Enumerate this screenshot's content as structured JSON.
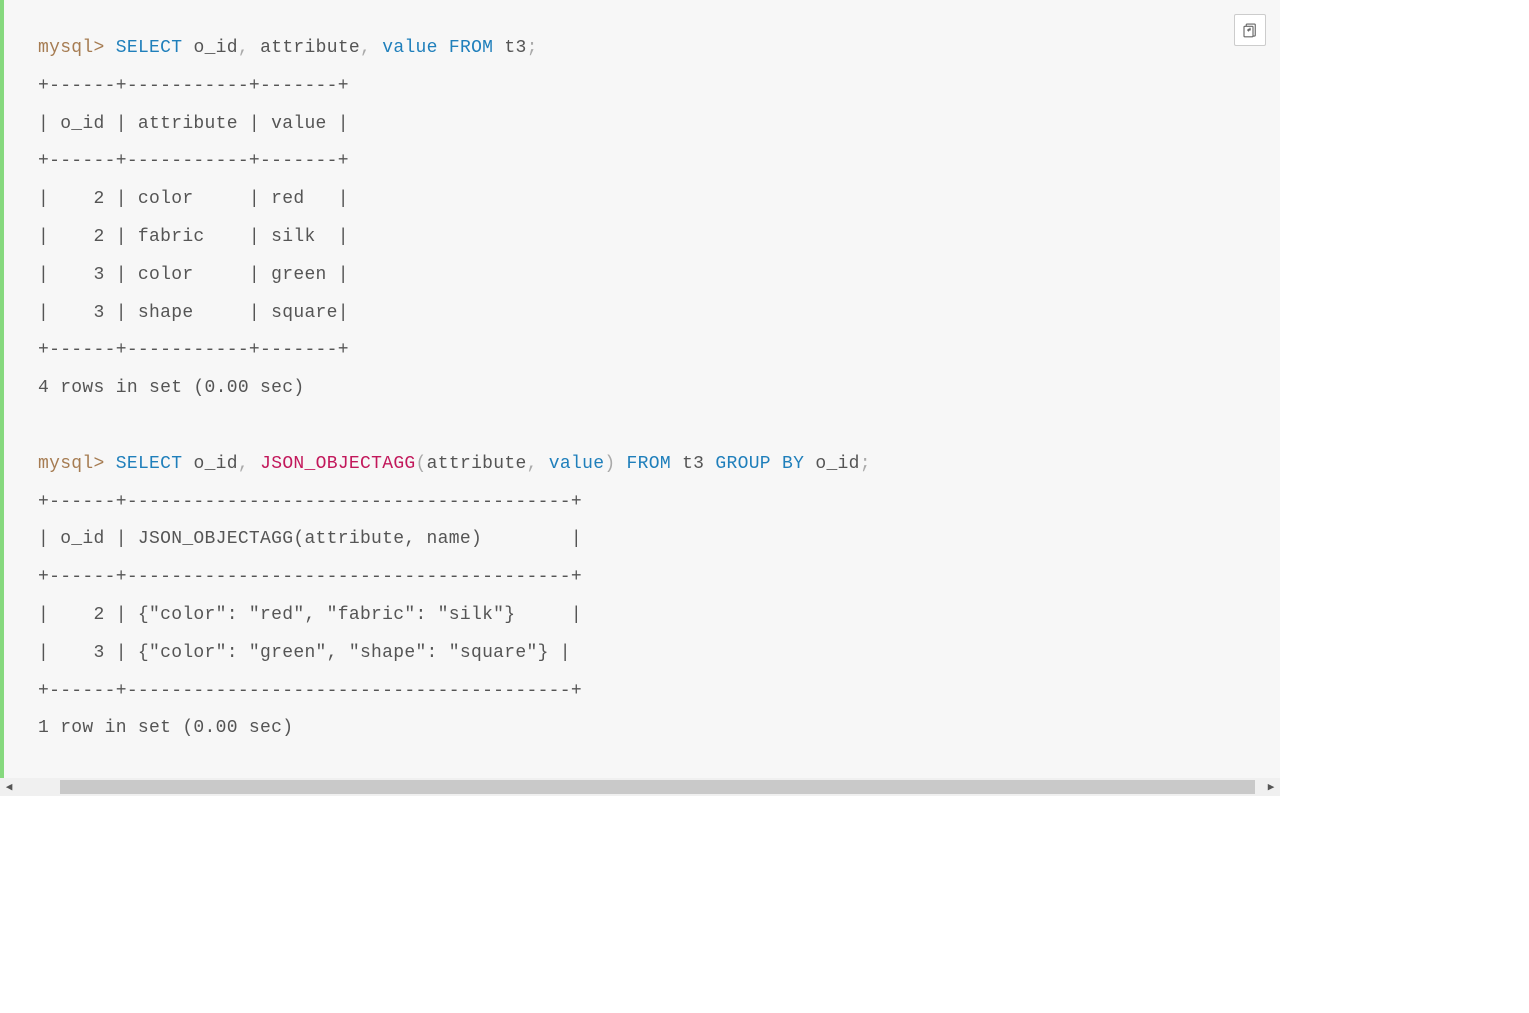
{
  "prompt": "mysql>",
  "query1": {
    "select": "SELECT",
    "col1": "o_id",
    "col2": "attribute",
    "col3": "value",
    "from": "FROM",
    "table": "t3",
    "sep_top": "+------+-----------+-------+",
    "header": "| o_id | attribute | value |",
    "sep_mid": "+------+-----------+-------+",
    "rows": [
      "|    2 | color     | red   |",
      "|    2 | fabric    | silk  |",
      "|    3 | color     | green |",
      "|    3 | shape     | square|"
    ],
    "sep_bot": "+------+-----------+-------+",
    "footer": "4 rows in set (0.00 sec)"
  },
  "query2": {
    "select": "SELECT",
    "col1": "o_id",
    "func": "JSON_OBJECTAGG",
    "arg1": "attribute",
    "arg2": "value",
    "from": "FROM",
    "table": "t3",
    "group": "GROUP",
    "by": "BY",
    "gcol": "o_id",
    "sep_top": "+------+----------------------------------------+",
    "header": "| o_id | JSON_OBJECTAGG(attribute, name)        |",
    "sep_mid": "+------+----------------------------------------+",
    "rows": [
      "|    2 | {\"color\": \"red\", \"fabric\": \"silk\"}     |",
      "|    3 | {\"color\": \"green\", \"shape\": \"square\"} |"
    ],
    "sep_bot": "+------+----------------------------------------+",
    "footer": "1 row in set (0.00 sec)"
  }
}
